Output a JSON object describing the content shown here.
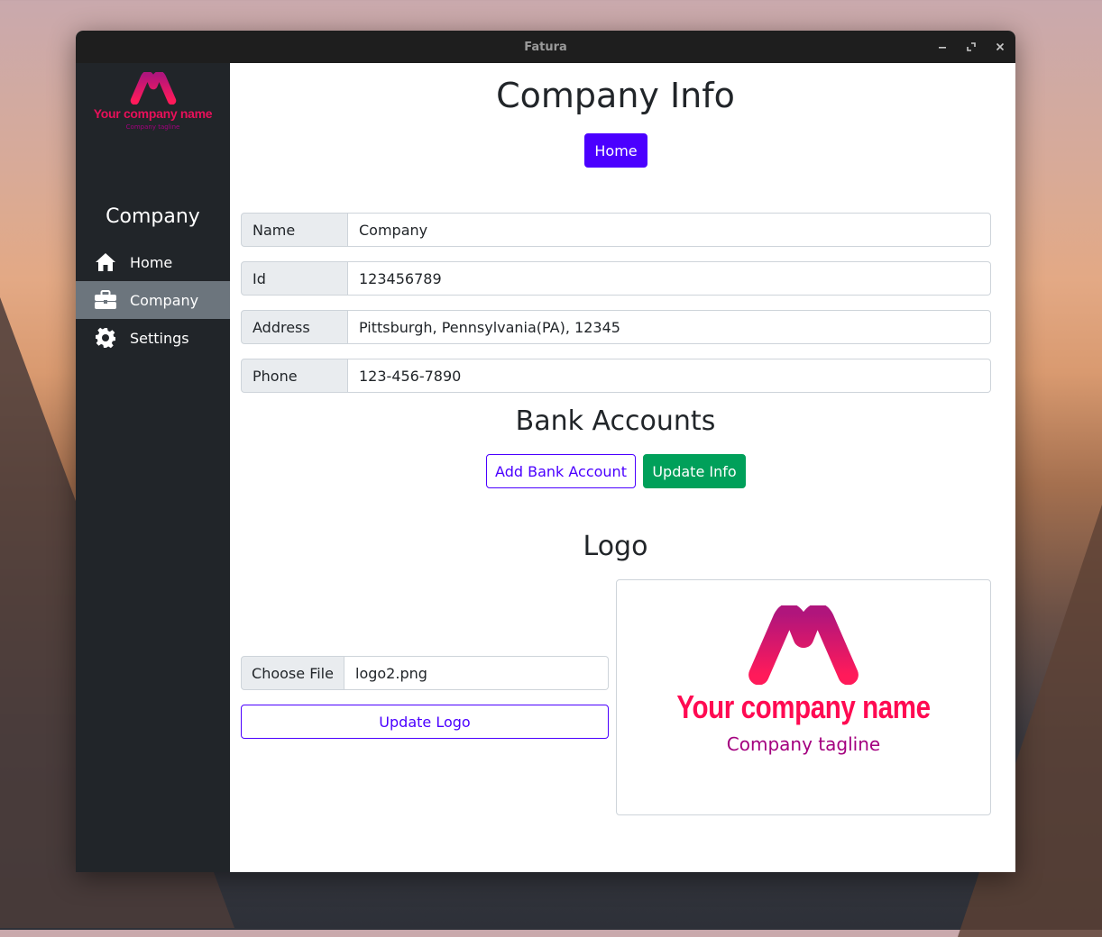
{
  "window": {
    "title": "Fatura"
  },
  "sidebar": {
    "logo_name": "Your company name",
    "logo_tagline": "Company tagline",
    "title": "Company",
    "items": [
      {
        "label": "Home",
        "icon": "home-icon"
      },
      {
        "label": "Company",
        "icon": "briefcase-icon",
        "active": true
      },
      {
        "label": "Settings",
        "icon": "gear-icon"
      }
    ]
  },
  "main": {
    "title": "Company Info",
    "home_button": "Home",
    "fields": [
      {
        "label": "Name",
        "value": "Company"
      },
      {
        "label": "Id",
        "value": "123456789"
      },
      {
        "label": "Address",
        "value": "Pittsburgh, Pennsylvania(PA), 12345"
      },
      {
        "label": "Phone",
        "value": "123-456-7890"
      }
    ],
    "bank_title": "Bank Accounts",
    "add_bank_button": "Add Bank Account",
    "update_info_button": "Update Info",
    "logo_title": "Logo",
    "choose_file_label": "Choose File",
    "file_name": "logo2.png",
    "update_logo_button": "Update Logo",
    "logo_preview": {
      "name": "Your company name",
      "tagline": "Company tagline"
    }
  },
  "colors": {
    "primary": "#4b00ff",
    "success": "#00a05a",
    "sidebar_bg": "#212529",
    "sidebar_active": "#6c757d",
    "logo_pink": "#ff0a52",
    "logo_purple": "#a4007f"
  }
}
